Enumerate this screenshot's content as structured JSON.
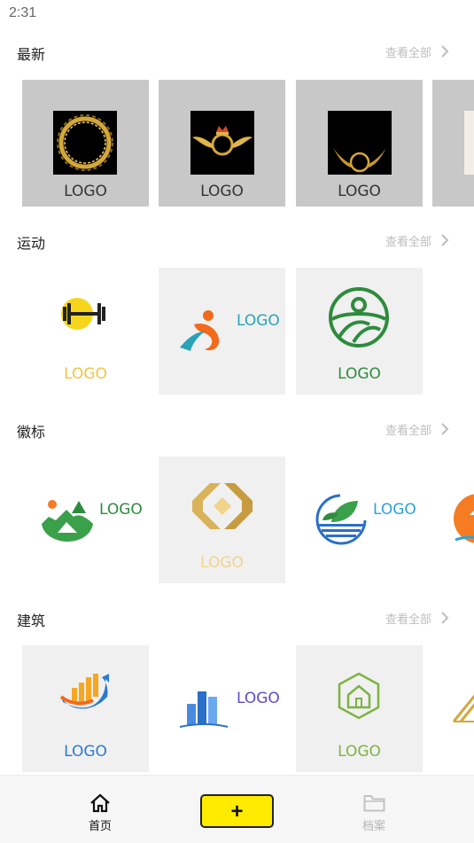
{
  "status": {
    "time": "2:31"
  },
  "see_all_label": "查看全部",
  "logo_text": "LOGO",
  "sections": [
    {
      "title": "最新"
    },
    {
      "title": "运动"
    },
    {
      "title": "徽标"
    },
    {
      "title": "建筑"
    }
  ],
  "nav": {
    "home_label": "首页",
    "add_label": "+",
    "archive_label": "档案"
  },
  "colors": {
    "gray_card": "#c8c8c8",
    "light_card": "#f0f0f0",
    "accent_yellow": "#ffeb00",
    "text_gold": "#f5c242",
    "text_teal": "#2aa3b8",
    "text_green": "#2e8b3d",
    "text_blue": "#2a7bd0",
    "text_purple": "#5a4cc8",
    "text_leaf_green": "#7cb342"
  },
  "icons": [
    "chevron-right-icon",
    "home-icon",
    "folder-icon"
  ]
}
